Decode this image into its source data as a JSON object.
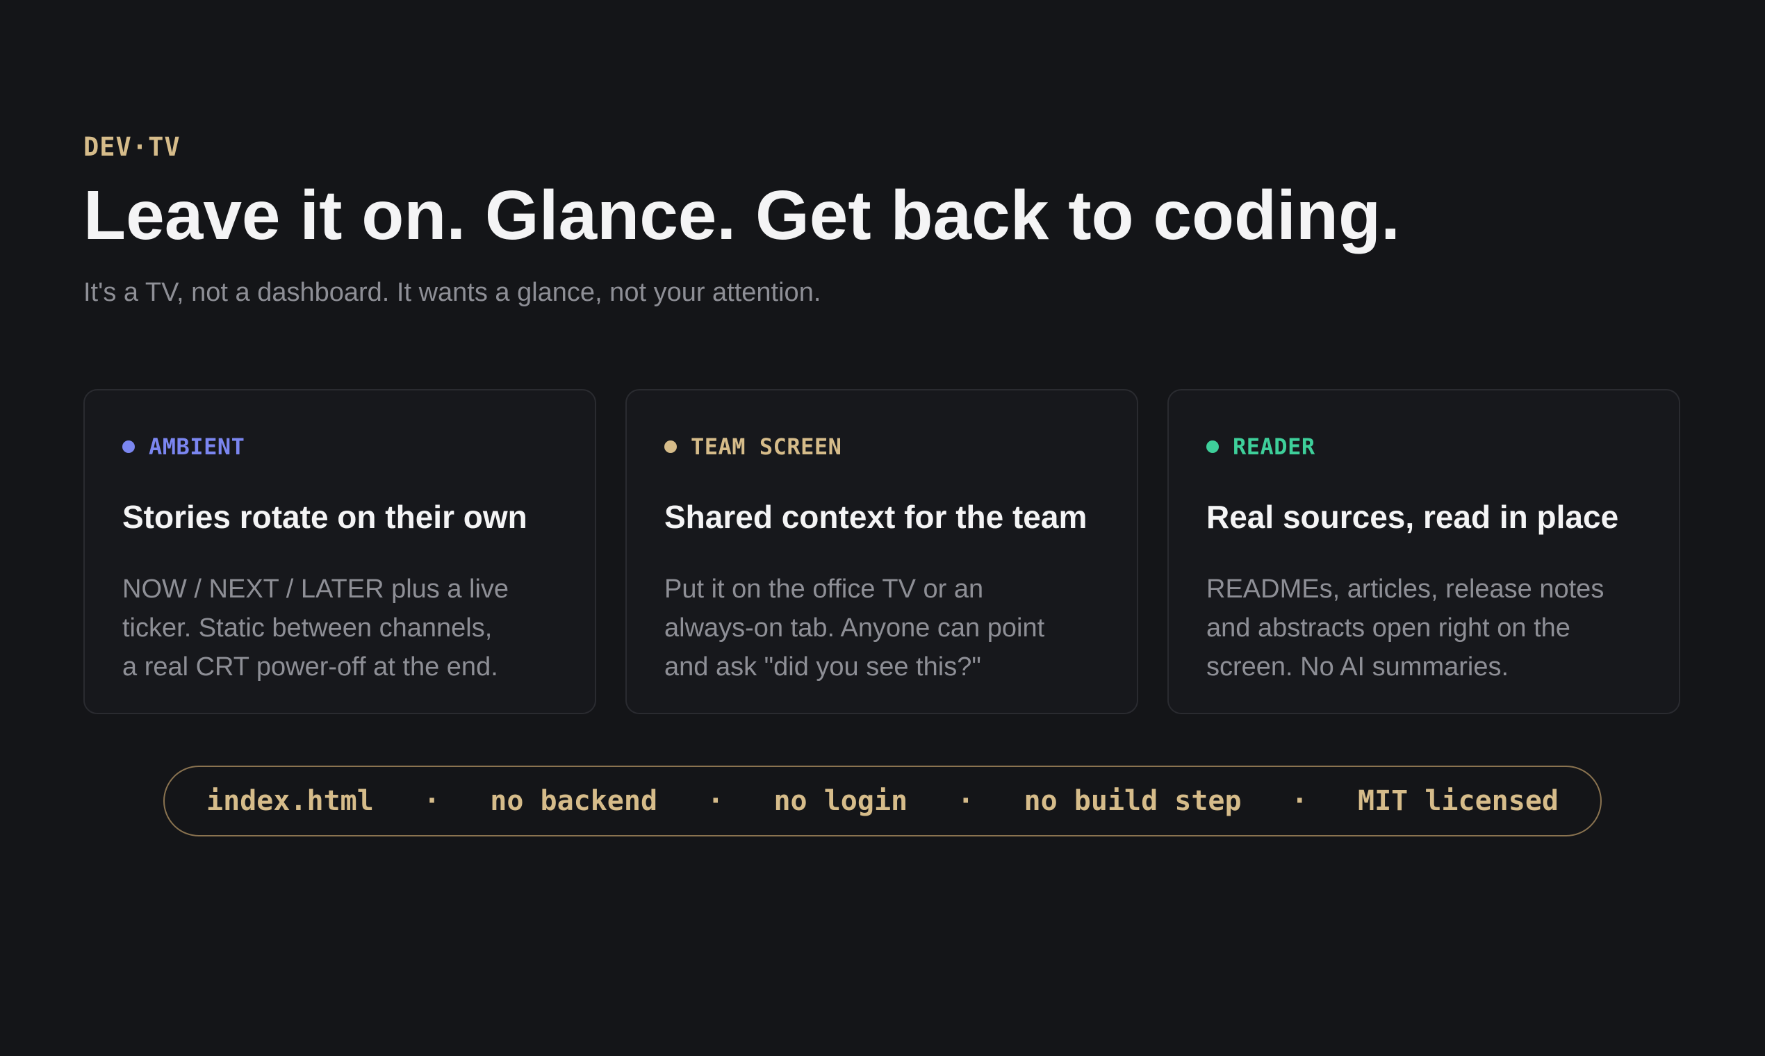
{
  "header": {
    "brand": "DEV·TV",
    "headline": "Leave it on. Glance. Get back to coding.",
    "subline": "It's a TV, not a dashboard. It wants a glance, not your attention."
  },
  "cards": [
    {
      "tag": "AMBIENT",
      "tag_color": "#7b86f0",
      "title": "Stories rotate on their own",
      "body_lines": [
        "NOW / NEXT / LATER plus a live",
        "ticker. Static between channels,",
        "a real CRT power-off at the end."
      ]
    },
    {
      "tag": "TEAM SCREEN",
      "tag_color": "#d6bc8a",
      "title": "Shared context for the team",
      "body_lines": [
        "Put it on the office TV or an",
        "always-on tab. Anyone can point",
        "and ask \"did you see this?\""
      ]
    },
    {
      "tag": "READER",
      "tag_color": "#3ecf9a",
      "title": "Real sources, read in place",
      "body_lines": [
        "READMEs, articles, release notes",
        "and abstracts open right on the",
        "screen. No AI summaries."
      ]
    }
  ],
  "features": {
    "items": [
      "index.html",
      "no backend",
      "no login",
      "no build step",
      "MIT licensed"
    ],
    "separator": "·"
  },
  "colors": {
    "background": "#141518",
    "accent": "#d6bc8a"
  }
}
